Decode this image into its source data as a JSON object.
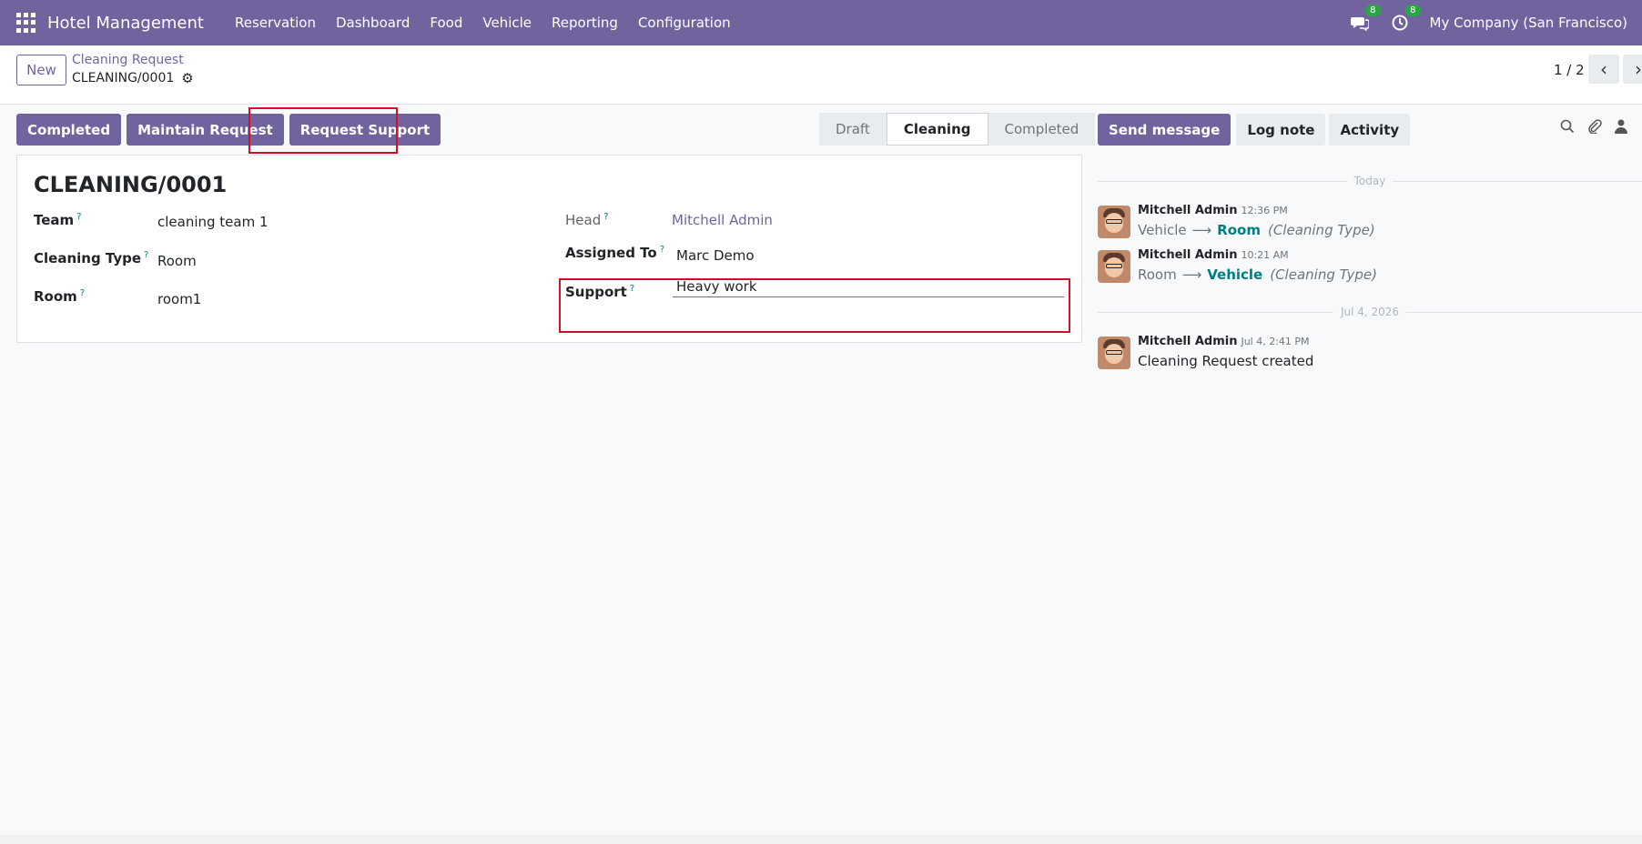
{
  "nav": {
    "brand": "Hotel Management",
    "menu": [
      "Reservation",
      "Dashboard",
      "Food",
      "Vehicle",
      "Reporting",
      "Configuration"
    ],
    "messages_badge": "8",
    "activity_badge": "8",
    "company": "My Company (San Francisco)"
  },
  "control": {
    "new_label": "New",
    "breadcrumb_parent": "Cleaning Request",
    "breadcrumb_current": "CLEANING/0001",
    "pager": "1 / 2"
  },
  "actions": {
    "completed": "Completed",
    "maintain": "Maintain Request",
    "request_support": "Request Support"
  },
  "statusbar": {
    "stages": [
      "Draft",
      "Cleaning",
      "Completed"
    ],
    "active": "Cleaning"
  },
  "form": {
    "title": "CLEANING/0001",
    "team_label": "Team",
    "team_value": "cleaning team 1",
    "cleaning_type_label": "Cleaning Type",
    "cleaning_type_value": "Room",
    "room_label": "Room",
    "room_value": "room1",
    "head_label": "Head",
    "head_value": "Mitchell Admin",
    "assigned_label": "Assigned To",
    "assigned_value": "Marc Demo",
    "support_label": "Support",
    "support_value": "Heavy work",
    "help_mark": "?"
  },
  "chatter": {
    "send_message": "Send message",
    "log_note": "Log note",
    "activity": "Activity",
    "sep_today": "Today",
    "sep_date": "Jul 4, 2026",
    "messages": [
      {
        "author": "Mitchell Admin",
        "time": "12:36 PM",
        "old": "Vehicle",
        "new": "Room",
        "field": "(Cleaning Type)"
      },
      {
        "author": "Mitchell Admin",
        "time": "10:21 AM",
        "old": "Room",
        "new": "Vehicle",
        "field": "(Cleaning Type)"
      },
      {
        "author": "Mitchell Admin",
        "time": "Jul 4, 2:41 PM",
        "text": "Cleaning Request created"
      }
    ]
  }
}
